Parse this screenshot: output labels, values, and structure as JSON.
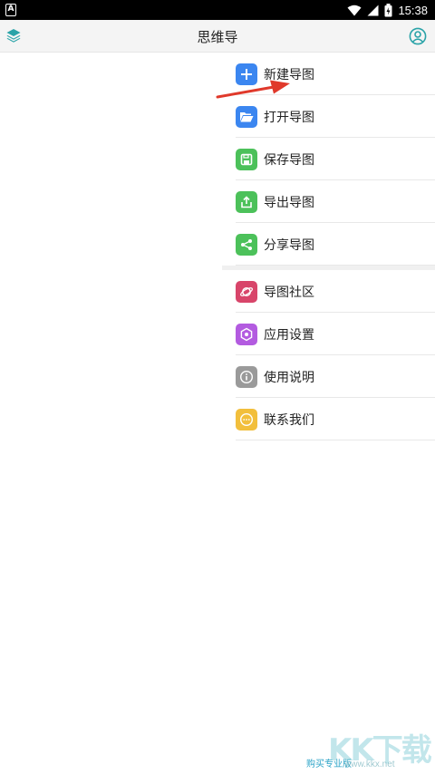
{
  "status_bar": {
    "time": "15:38"
  },
  "app_bar": {
    "title": "思维导"
  },
  "menu": {
    "group1": [
      {
        "label": "新建导图",
        "icon": "plus-icon",
        "color": "#3b86f0"
      },
      {
        "label": "打开导图",
        "icon": "folder-open-icon",
        "color": "#3b86f0"
      },
      {
        "label": "保存导图",
        "icon": "save-icon",
        "color": "#4cc15a"
      },
      {
        "label": "导出导图",
        "icon": "export-icon",
        "color": "#4cc15a"
      },
      {
        "label": "分享导图",
        "icon": "share-icon",
        "color": "#4cc15a"
      }
    ],
    "group2": [
      {
        "label": "导图社区",
        "icon": "planet-icon",
        "color": "#d8456a"
      },
      {
        "label": "应用设置",
        "icon": "settings-icon",
        "color": "#b35be0"
      },
      {
        "label": "使用说明",
        "icon": "info-icon",
        "color": "#9a9a9a"
      },
      {
        "label": "联系我们",
        "icon": "chat-icon",
        "color": "#f2bf3c"
      }
    ]
  },
  "footer": {
    "buy_label": "购买专业版"
  },
  "watermark": {
    "text": "KK下载",
    "url": "www.kkx.net"
  },
  "colors": {
    "accent": "#2aa3c7",
    "annotation_arrow": "#e0392b"
  }
}
